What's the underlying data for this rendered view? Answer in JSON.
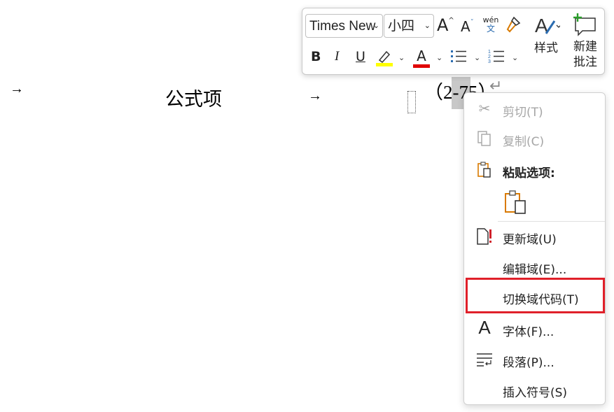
{
  "document": {
    "arrow1": "→",
    "formula_label": "公式项",
    "arrow2": "→",
    "equation_number": "（2-75）",
    "paragraph_mark": "↵"
  },
  "toolbar": {
    "font_name": "Times New",
    "font_size": "小四",
    "grow_font": "A",
    "shrink_font": "A",
    "phonetic_top": "wén",
    "phonetic_bottom": "文",
    "bold": "B",
    "italic": "I",
    "underline": "U",
    "font_color": "A",
    "styles_label": "样式",
    "new_comment_label_1": "新建",
    "new_comment_label_2": "批注",
    "highlight_color": "#ffff00",
    "font_color_value": "#e00000"
  },
  "menu": {
    "cut": "剪切(T)",
    "copy": "复制(C)",
    "paste_options": "粘贴选项:",
    "update_field": "更新域(U)",
    "edit_field": "编辑域(E)...",
    "toggle_field_codes": "切换域代码(T)",
    "font": "字体(F)...",
    "paragraph": "段落(P)...",
    "insert_symbol": "插入符号(S)"
  }
}
